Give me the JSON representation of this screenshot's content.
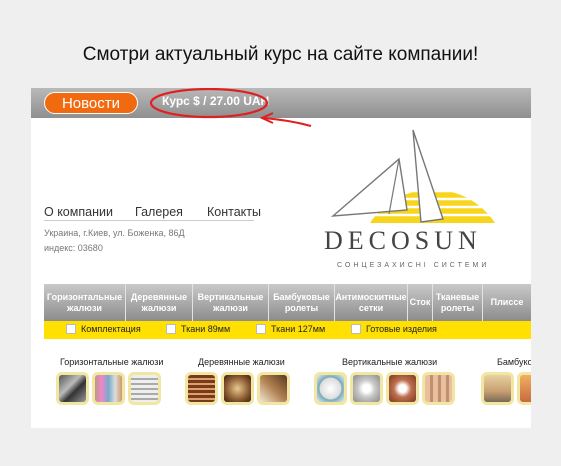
{
  "caption": "Смотри актуальный курс на сайте компании!",
  "topbar": {
    "news_label": "Новости",
    "rate_text": "Курс $ / 27.00 UAH"
  },
  "nav": [
    "О компании",
    "Галерея",
    "Контакты"
  ],
  "address": {
    "line1": "Украина, г.Киев, ул. Боженка, 86Д",
    "line2": "индекс: 03680"
  },
  "logo": {
    "name": "DECOSUN",
    "tagline": "СОНЦЕЗАХИСНІ СИСТЕМИ"
  },
  "menu": [
    "Горизонтальные жалюзи",
    "Деревянные жалюзи",
    "Вертикальные жалюзи",
    "Бамбуковые ролеты",
    "Антимоскитные сетки",
    "Сток",
    "Тканевые ролеты",
    "Плиссе"
  ],
  "submenu": [
    "Комплектация",
    "Ткани 89мм",
    "Ткани 127мм",
    "Готовые изделия"
  ],
  "categories": [
    "Горизонтальные жалюзи",
    "Деревянные жалюзи",
    "Вертикальные жалюзи",
    "Бамбуковые"
  ],
  "colors": {
    "accent_orange": "#f26a10",
    "annotation_red": "#e02020",
    "yellow_bar": "#ffe000",
    "logo_yellow": "#f7d51c"
  }
}
